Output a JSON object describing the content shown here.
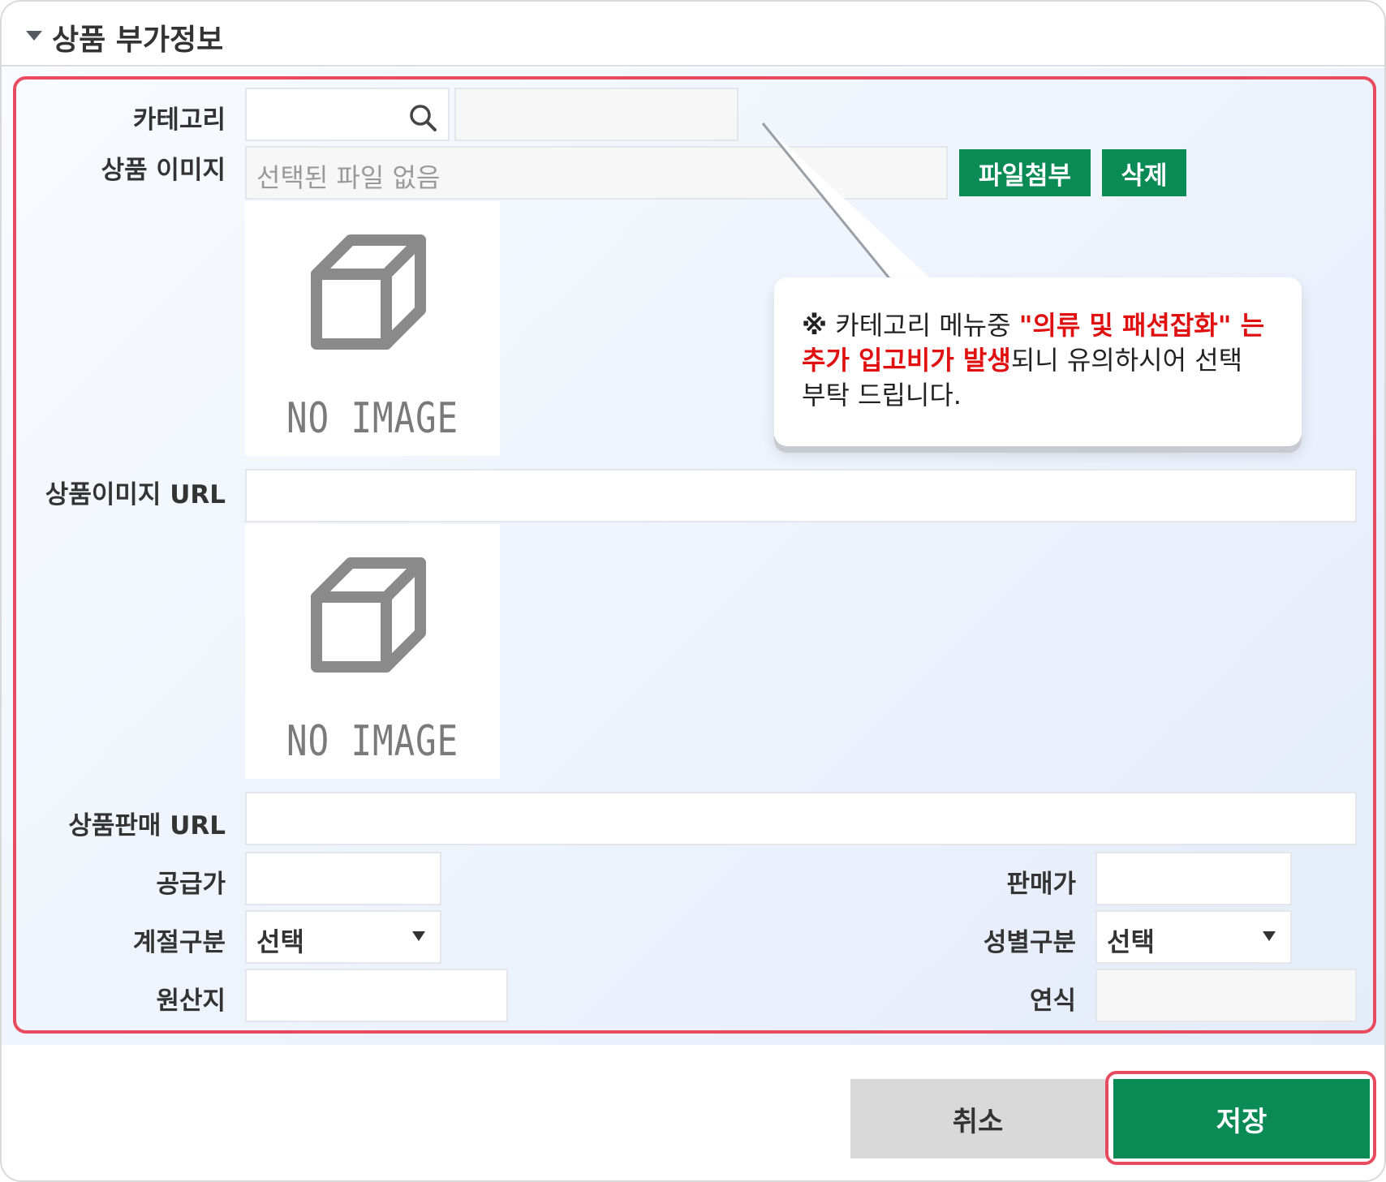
{
  "header": {
    "title": "상품 부가정보"
  },
  "category": {
    "label": "카테고리"
  },
  "product_image": {
    "label": "상품 이미지",
    "file_placeholder": "선택된 파일 없음",
    "attach_button": "파일첨부",
    "delete_button": "삭제",
    "no_image_text": "NO IMAGE"
  },
  "product_image_url": {
    "label": "상품이미지 URL",
    "no_image_text": "NO IMAGE"
  },
  "product_sale_url": {
    "label": "상품판매 URL"
  },
  "supply_price": {
    "label": "공급가"
  },
  "sale_price": {
    "label": "판매가"
  },
  "season": {
    "label": "계절구분",
    "value": "선택"
  },
  "gender": {
    "label": "성별구분",
    "value": "선택"
  },
  "origin": {
    "label": "원산지"
  },
  "model_year": {
    "label": "연식"
  },
  "tooltip": {
    "mark": "※",
    "text1": " 카테고리 메뉴중 ",
    "red1": "\"의류 및 패션잡화\" 는",
    "red2": "추가 입고비가 발생",
    "text2": "되니 유의하시어 선택",
    "text3": "부탁 드립니다."
  },
  "footer": {
    "cancel_label": "취소",
    "save_label": "저장"
  },
  "colors": {
    "accent_green": "#0a8a55",
    "highlight_red": "#e84a5f",
    "tooltip_red": "#e01010"
  }
}
